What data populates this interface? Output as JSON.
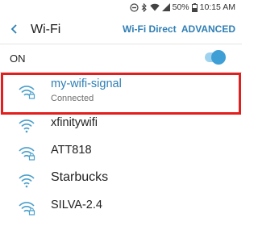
{
  "status_bar": {
    "battery": "50%",
    "time": "10:15 AM",
    "icons": [
      "do-not-disturb-icon",
      "bluetooth-icon",
      "wifi-icon",
      "signal-icon",
      "battery-icon"
    ]
  },
  "header": {
    "title": "Wi-Fi",
    "wifi_direct": "Wi-Fi Direct",
    "advanced": "ADVANCED"
  },
  "wifi_toggle": {
    "label": "ON",
    "enabled": true
  },
  "networks": [
    {
      "name": "my-wifi-signal",
      "status": "Connected",
      "secured": true
    },
    {
      "name": "xfinitywifi",
      "secured": false
    },
    {
      "name": "ATT818",
      "secured": true
    },
    {
      "name": "Starbucks",
      "secured": false
    },
    {
      "name": "SILVA-2.4",
      "secured": true
    }
  ],
  "colors": {
    "accent": "#2f7fb5",
    "wifi_icon": "#4a9fcb",
    "toggle_on": "#3d9fd6",
    "highlight_box": "#e41d1d"
  }
}
